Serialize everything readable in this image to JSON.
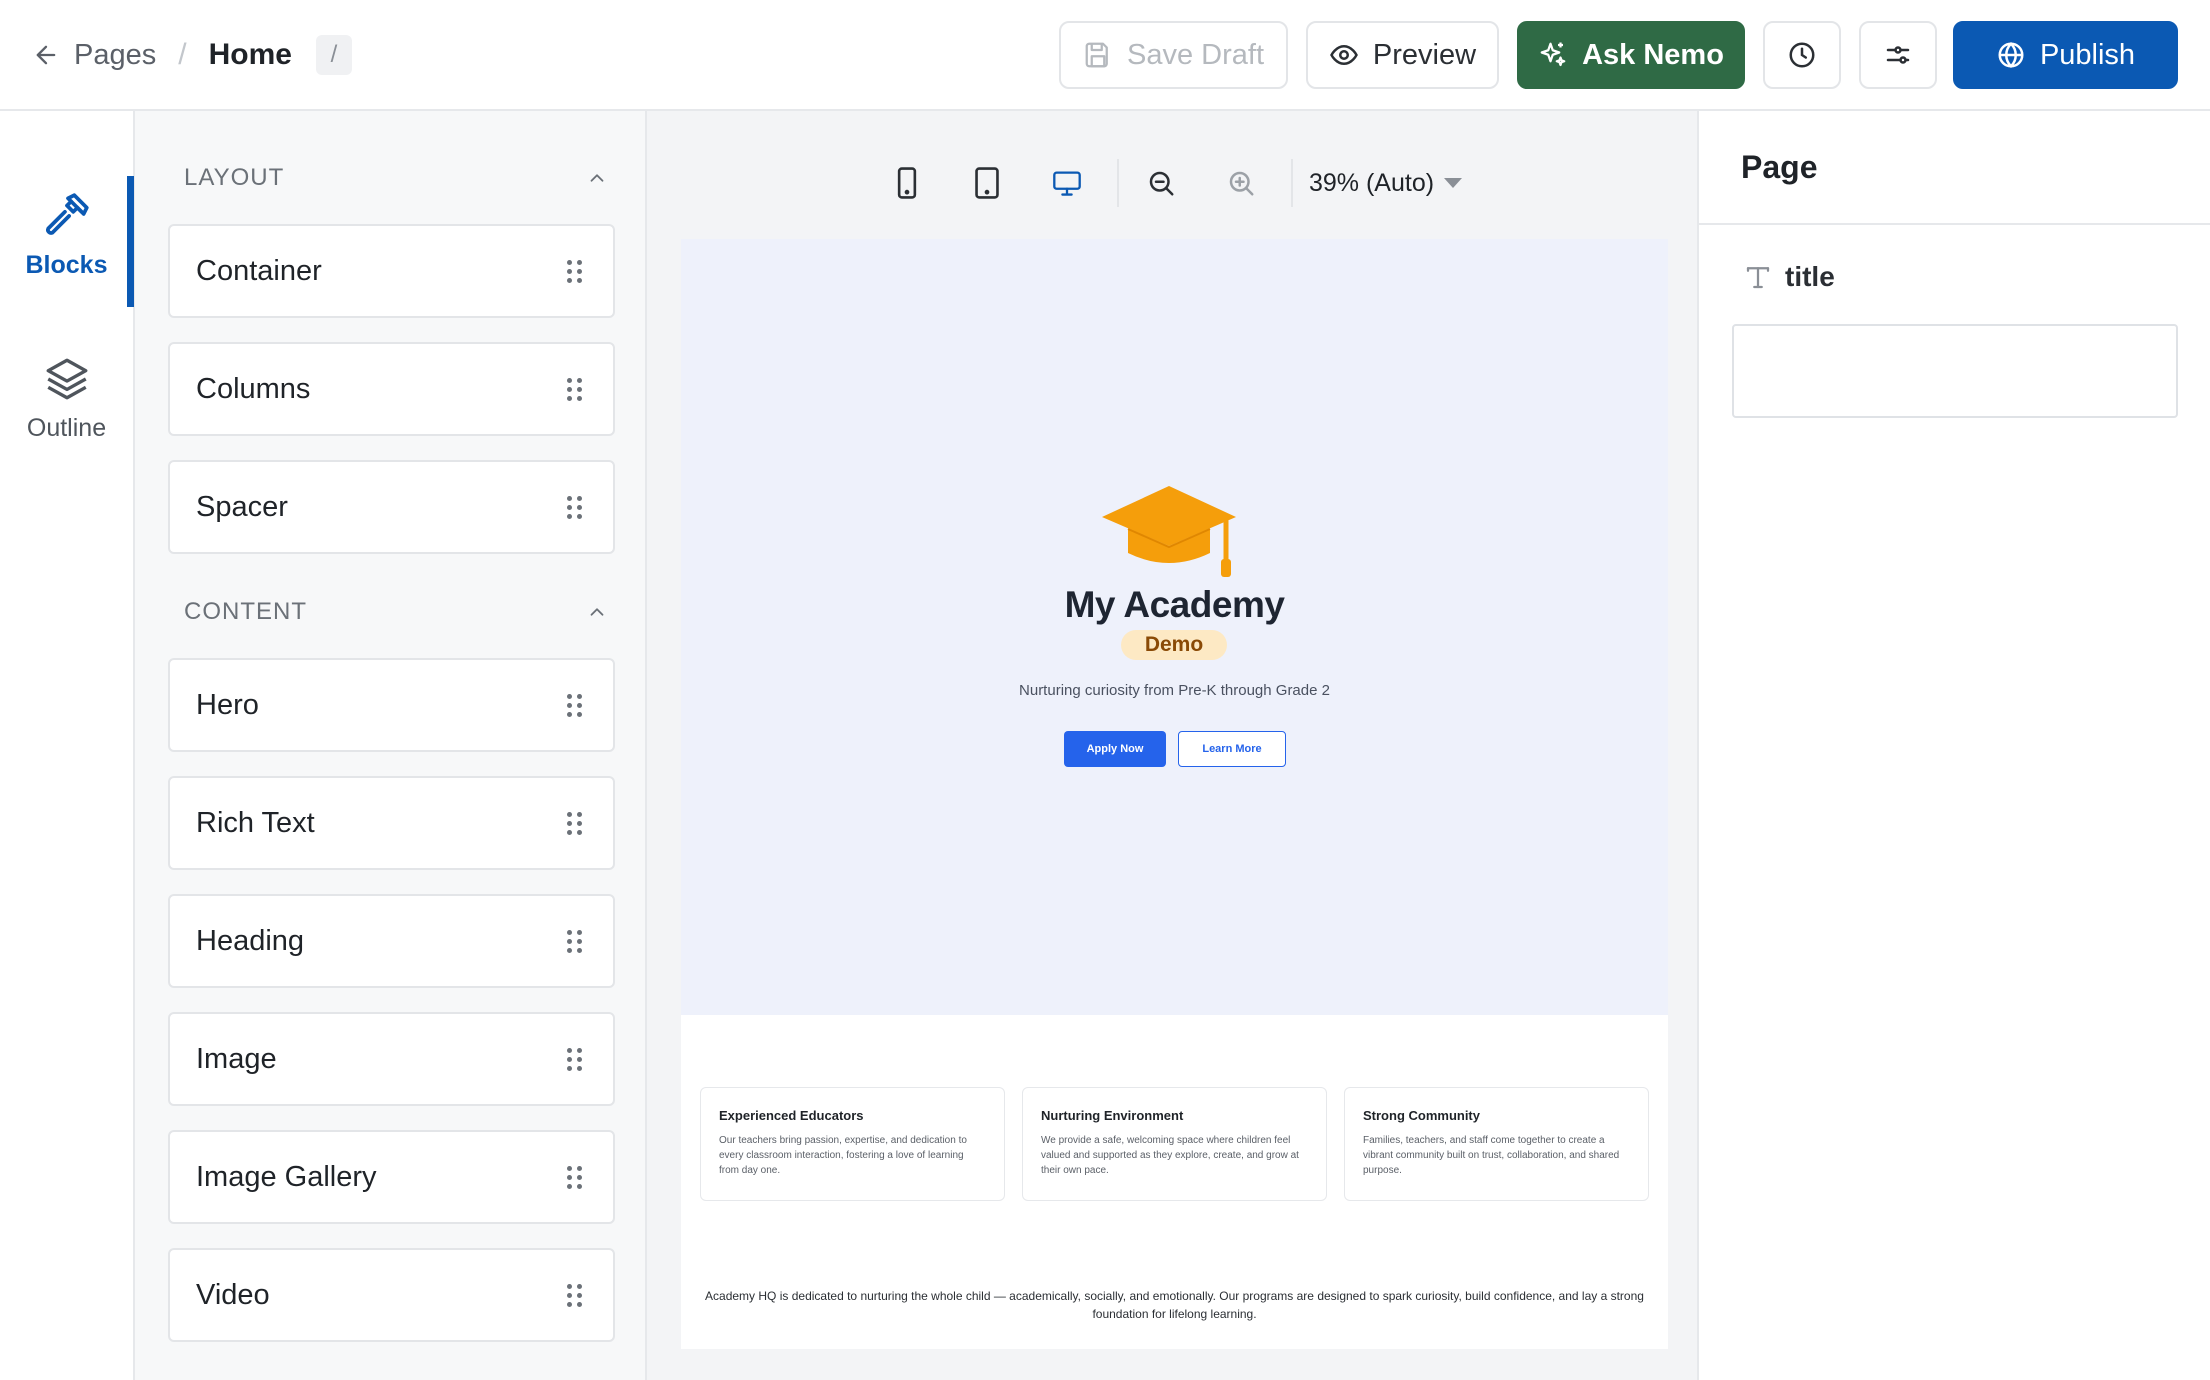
{
  "header": {
    "back_label": "Pages",
    "breadcrumb_current": "Home",
    "slug": "/",
    "save_draft": "Save Draft",
    "preview": "Preview",
    "ask_nemo": "Ask Nemo",
    "publish": "Publish"
  },
  "rail": {
    "blocks": "Blocks",
    "outline": "Outline"
  },
  "blocks_panel": {
    "sections": [
      {
        "title": "LAYOUT",
        "items": [
          "Container",
          "Columns",
          "Spacer"
        ]
      },
      {
        "title": "CONTENT",
        "items": [
          "Hero",
          "Rich Text",
          "Heading",
          "Image",
          "Image Gallery",
          "Video"
        ]
      }
    ]
  },
  "canvas": {
    "zoom": "39% (Auto)",
    "active_device": "desktop",
    "site": {
      "name": "My Academy",
      "badge": "Demo",
      "tagline": "Nurturing curiosity from Pre-K through Grade 2",
      "primary_cta": "Apply Now",
      "secondary_cta": "Learn More",
      "features": [
        {
          "title": "Experienced Educators",
          "text": "Our teachers bring passion, expertise, and dedication to every classroom interaction, fostering a love of learning from day one."
        },
        {
          "title": "Nurturing Environment",
          "text": "We provide a safe, welcoming space where children feel valued and supported as they explore, create, and grow at their own pace."
        },
        {
          "title": "Strong Community",
          "text": "Families, teachers, and staff come together to create a vibrant community built on trust, collaboration, and shared purpose."
        }
      ],
      "mission": "Academy HQ is dedicated to nurturing the whole child — academically, socially, and emotionally. Our programs are designed to spark curiosity, build confidence, and lay a strong foundation for lifelong learning."
    }
  },
  "properties": {
    "title": "Page",
    "field_label": "title",
    "field_value": ""
  },
  "colors": {
    "primary": "#0b59b3",
    "nemo": "#2f6a45",
    "site_accent": "#2563eb",
    "logo": "#f59e0b"
  },
  "icons": {
    "back": "arrow-left-icon",
    "save": "floppy-icon",
    "preview": "eye-icon",
    "nemo": "sparkles-icon",
    "history": "clock-icon",
    "settings": "sliders-icon",
    "publish": "globe-icon",
    "blocks": "hammer-icon",
    "outline": "layers-icon",
    "text_field": "text-type-icon"
  }
}
